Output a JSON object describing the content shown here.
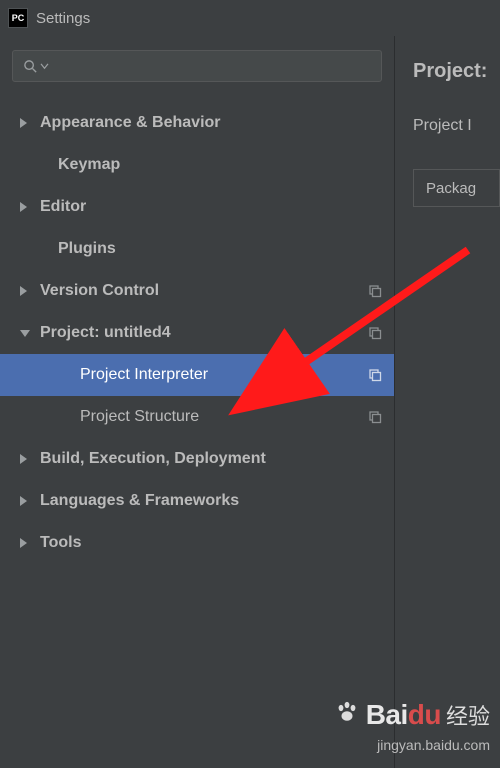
{
  "window": {
    "title": "Settings",
    "app_icon_label": "PC"
  },
  "search": {
    "placeholder": ""
  },
  "tree": {
    "items": [
      {
        "label": "Appearance & Behavior",
        "expandable": true,
        "state": "collapsed",
        "bold": true
      },
      {
        "label": "Keymap",
        "expandable": false,
        "bold": true
      },
      {
        "label": "Editor",
        "expandable": true,
        "state": "collapsed",
        "bold": true
      },
      {
        "label": "Plugins",
        "expandable": false,
        "bold": true
      },
      {
        "label": "Version Control",
        "expandable": true,
        "state": "collapsed",
        "bold": true,
        "copy": true
      },
      {
        "label": "Project: untitled4",
        "expandable": true,
        "state": "expanded",
        "bold": true,
        "copy": true,
        "children_indices": [
          6,
          7
        ]
      },
      {
        "label": "Project Interpreter",
        "child": true,
        "selected": true,
        "copy": true
      },
      {
        "label": "Project Structure",
        "child": true,
        "copy": true
      },
      {
        "label": "Build, Execution, Deployment",
        "expandable": true,
        "state": "collapsed",
        "bold": true
      },
      {
        "label": "Languages & Frameworks",
        "expandable": true,
        "state": "collapsed",
        "bold": true
      },
      {
        "label": "Tools",
        "expandable": true,
        "state": "collapsed",
        "bold": true
      }
    ]
  },
  "main": {
    "heading_prefix": "Project:",
    "label_fragment": "Project I",
    "table_header_fragment": "Packag"
  },
  "watermark": {
    "brand_latin": "Bai",
    "brand_ch": "du",
    "brand_cn": "经验",
    "url": "jingyan.baidu.com"
  }
}
